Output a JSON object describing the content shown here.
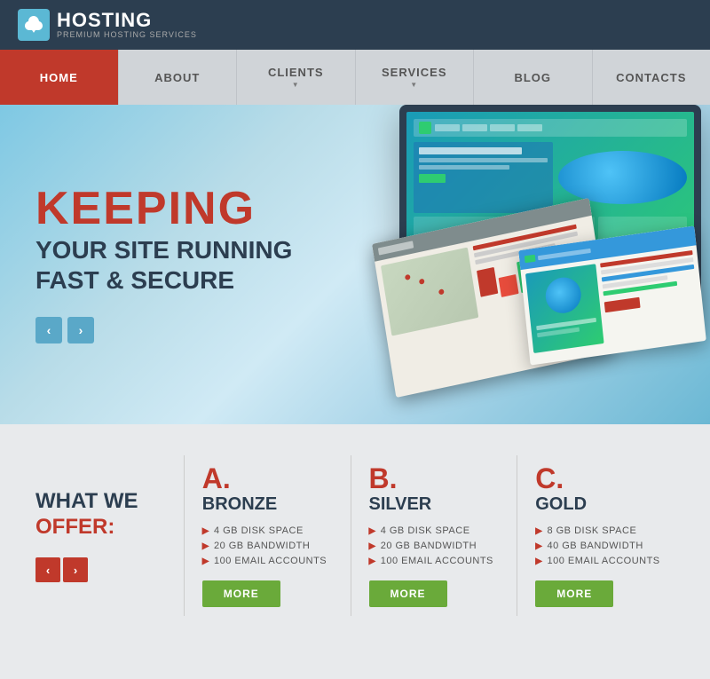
{
  "header": {
    "logo_title": "HOSTING",
    "logo_subtitle": "PREMIUM HOSTING SERVICES"
  },
  "nav": {
    "items": [
      {
        "label": "HOME",
        "active": true,
        "has_arrow": false
      },
      {
        "label": "ABOUT",
        "active": false,
        "has_arrow": false
      },
      {
        "label": "CLIENTS",
        "active": false,
        "has_arrow": true
      },
      {
        "label": "SERVICES",
        "active": false,
        "has_arrow": true
      },
      {
        "label": "BLOG",
        "active": false,
        "has_arrow": false
      },
      {
        "label": "CONTACTS",
        "active": false,
        "has_arrow": false
      }
    ]
  },
  "hero": {
    "heading_red": "KEEPING",
    "heading_dark": "YOUR SITE RUNNING\nFAST & SECURE",
    "prev_arrow": "‹",
    "next_arrow": "›"
  },
  "pricing": {
    "section_title_line1": "WHAT WE",
    "section_title_line2": "OFFER:",
    "prev_arrow": "‹",
    "next_arrow": "›",
    "plans": [
      {
        "letter": "A.",
        "name": "BRONZE",
        "features": [
          "4 GB DISK SPACE",
          "20 GB BANDWIDTH",
          "100 EMAIL ACCOUNTS"
        ],
        "more_label": "MORE"
      },
      {
        "letter": "B.",
        "name": "SILVER",
        "features": [
          "4 GB DISK SPACE",
          "20 GB BANDWIDTH",
          "100 EMAIL ACCOUNTS"
        ],
        "more_label": "MORE"
      },
      {
        "letter": "C.",
        "name": "GOLD",
        "features": [
          "8 GB DISK SPACE",
          "40 GB BANDWIDTH",
          "100 EMAIL ACCOUNTS"
        ],
        "more_label": "MORE"
      }
    ]
  }
}
